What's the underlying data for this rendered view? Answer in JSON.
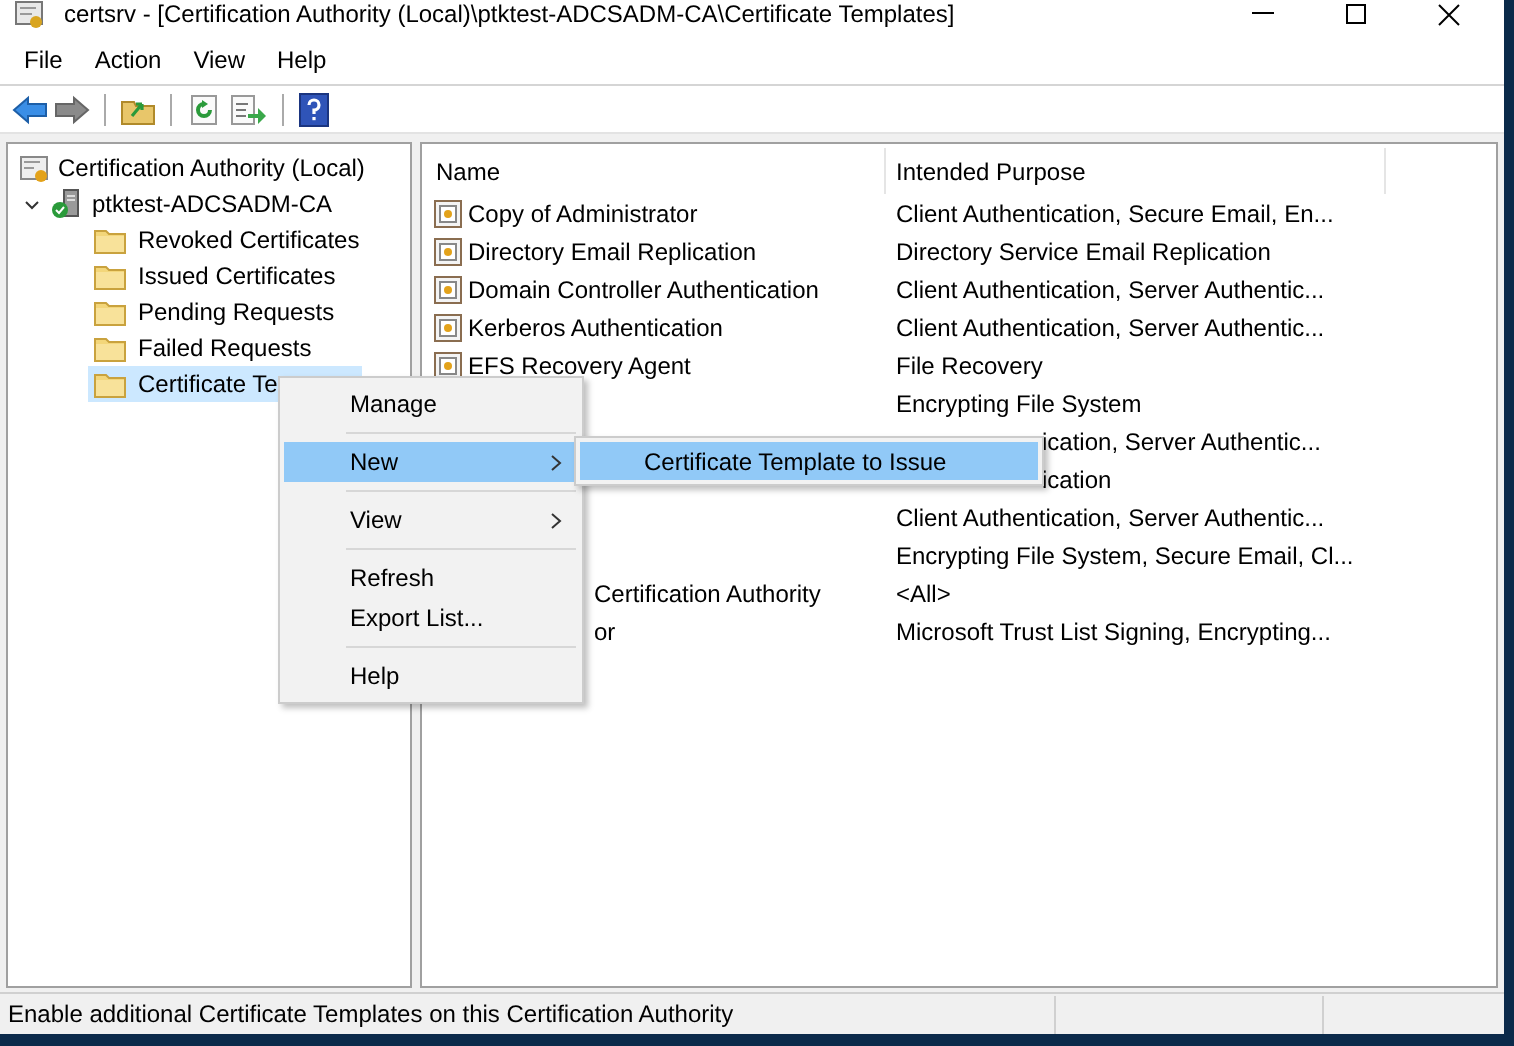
{
  "window": {
    "title": "certsrv - [Certification Authority (Local)\\ptktest-ADCSADM-CA\\Certificate Templates]"
  },
  "menu_bar": [
    "File",
    "Action",
    "View",
    "Help"
  ],
  "tree": {
    "label": "Certification Authority (Local)",
    "children": [
      {
        "label": "ptktest-ADCSADM-CA",
        "expanded": true,
        "selected": false,
        "children": [
          {
            "label": "Revoked Certificates",
            "selected": false
          },
          {
            "label": "Issued Certificates",
            "selected": false
          },
          {
            "label": "Pending Requests",
            "selected": false
          },
          {
            "label": "Failed Requests",
            "selected": false
          },
          {
            "label": "Certificate Te",
            "selected": true
          }
        ]
      }
    ]
  },
  "list": {
    "columns": [
      "Name",
      "Intended Purpose"
    ],
    "rows": [
      {
        "kind": "plain",
        "name": "Copy of Administrator",
        "purpose": "Client Authentication, Secure Email, En..."
      },
      {
        "kind": "plain",
        "name": "Directory Email Replication",
        "purpose": "Directory Service Email Replication"
      },
      {
        "kind": "plain",
        "name": "Domain Controller Authentication",
        "purpose": "Client Authentication, Server Authentic..."
      },
      {
        "kind": "plain",
        "name": "Kerberos Authentication",
        "purpose": "Client Authentication, Server Authentic..."
      },
      {
        "kind": "plain",
        "name": "EFS Recovery Agent",
        "purpose": "File Recovery"
      },
      {
        "kind": "name-covered",
        "purpose": "Encrypting File System"
      },
      {
        "kind": "purpose-covered",
        "purpose": "ication, Server Authentic..."
      },
      {
        "kind": "purpose-covered",
        "purpose": "ication"
      },
      {
        "kind": "name-covered",
        "purpose": "Client Authentication, Server Authentic..."
      },
      {
        "kind": "name-covered",
        "purpose": "Encrypting File System, Secure Email, Cl..."
      },
      {
        "kind": "name-covered",
        "name": "Certification Authority",
        "purpose": "<All>"
      },
      {
        "kind": "name-covered",
        "name": "or",
        "purpose": "Microsoft Trust List Signing, Encrypting..."
      }
    ]
  },
  "context_menu": {
    "items": [
      {
        "kind": "item",
        "label": "Manage",
        "submenu": false,
        "selected": false
      },
      {
        "kind": "separator"
      },
      {
        "kind": "item",
        "label": "New",
        "submenu": true,
        "selected": true
      },
      {
        "kind": "separator"
      },
      {
        "kind": "item",
        "label": "View",
        "submenu": true,
        "selected": false
      },
      {
        "kind": "separator"
      },
      {
        "kind": "item",
        "label": "Refresh",
        "submenu": false,
        "selected": false
      },
      {
        "kind": "item",
        "label": "Export List...",
        "submenu": false,
        "selected": false
      },
      {
        "kind": "separator"
      },
      {
        "kind": "item",
        "label": "Help",
        "submenu": false,
        "selected": false
      }
    ]
  },
  "submenu": {
    "items": [
      {
        "label": "Certificate Template to Issue",
        "selected": true
      }
    ]
  },
  "status_bar": {
    "text": "Enable additional Certificate Templates on this Certification Authority"
  }
}
